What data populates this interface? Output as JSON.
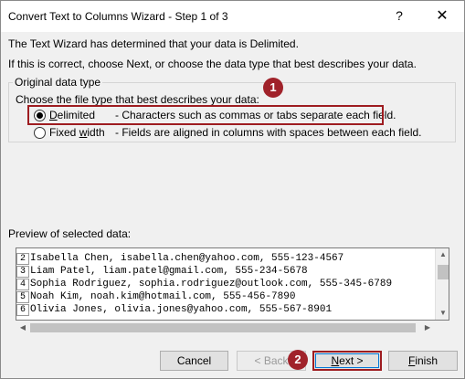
{
  "window": {
    "title": "Convert Text to Columns Wizard - Step 1 of 3",
    "help_label": "?",
    "close_label": "✕"
  },
  "intro": {
    "line1": "The Text Wizard has determined that your data is Delimited.",
    "line2": "If this is correct, choose Next, or choose the data type that best describes your data."
  },
  "group": {
    "label": "Original data type",
    "description": "Choose the file type that best describes your data:",
    "options": [
      {
        "label": "Delimited",
        "accel": "D",
        "rest": "elimited",
        "description": "- Characters such as commas or tabs separate each field.",
        "selected": true
      },
      {
        "label": "Fixed width",
        "accel": "w",
        "pre": "Fixed ",
        "rest": "idth",
        "description": "- Fields are aligned in columns with spaces between each field.",
        "selected": false
      }
    ]
  },
  "badges": [
    "1",
    "2"
  ],
  "preview": {
    "label": "Preview of selected data:",
    "rows": [
      {
        "num": "2",
        "text": "Isabella Chen, isabella.chen@yahoo.com, 555-123-4567"
      },
      {
        "num": "3",
        "text": "Liam Patel, liam.patel@gmail.com, 555-234-5678"
      },
      {
        "num": "4",
        "text": "Sophia Rodriguez, sophia.rodriguez@outlook.com, 555-345-6789"
      },
      {
        "num": "5",
        "text": "Noah Kim, noah.kim@hotmail.com, 555-456-7890"
      },
      {
        "num": "6",
        "text": "Olivia Jones, olivia.jones@yahoo.com, 555-567-8901"
      }
    ]
  },
  "buttons": {
    "cancel": "Cancel",
    "back": "< Back",
    "next_accel": "N",
    "next_rest": "ext >",
    "finish_accel": "F",
    "finish_rest": "inish"
  },
  "colors": {
    "highlight": "#9e1c20",
    "badge": "#a0222a",
    "focus": "#0078d7"
  }
}
